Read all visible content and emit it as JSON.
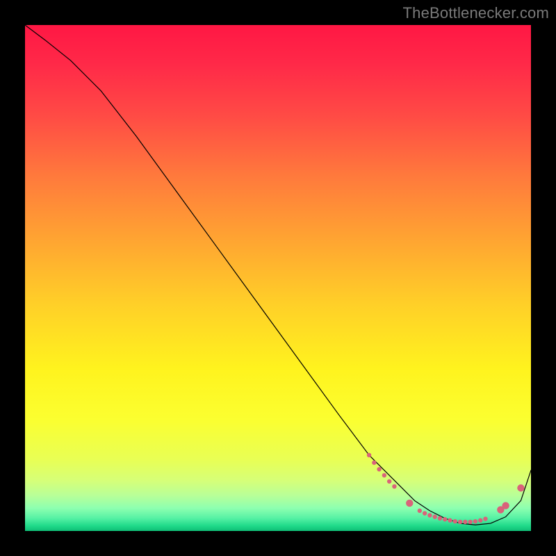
{
  "watermark": "TheBottlenecker.com",
  "chart_data": {
    "type": "line",
    "title": "",
    "xlabel": "",
    "ylabel": "",
    "xlim": [
      0,
      100
    ],
    "ylim": [
      0,
      100
    ],
    "legend": false,
    "grid": false,
    "background_gradient": {
      "stops": [
        {
          "pos": 0.0,
          "color": "#ff1744"
        },
        {
          "pos": 0.08,
          "color": "#ff2a48"
        },
        {
          "pos": 0.18,
          "color": "#ff4b45"
        },
        {
          "pos": 0.3,
          "color": "#ff7a3c"
        },
        {
          "pos": 0.42,
          "color": "#ffa332"
        },
        {
          "pos": 0.55,
          "color": "#ffcf28"
        },
        {
          "pos": 0.68,
          "color": "#fff31e"
        },
        {
          "pos": 0.78,
          "color": "#fbff30"
        },
        {
          "pos": 0.86,
          "color": "#e8ff55"
        },
        {
          "pos": 0.9,
          "color": "#d6ff78"
        },
        {
          "pos": 0.93,
          "color": "#b8ff98"
        },
        {
          "pos": 0.955,
          "color": "#8dffb0"
        },
        {
          "pos": 0.975,
          "color": "#55f1a4"
        },
        {
          "pos": 0.99,
          "color": "#1fd989"
        },
        {
          "pos": 1.0,
          "color": "#0fbf76"
        }
      ]
    },
    "series": [
      {
        "name": "curve",
        "color": "#000000",
        "width": 1.2,
        "x": [
          0,
          4,
          9,
          15,
          22,
          30,
          38,
          46,
          54,
          62,
          68,
          73,
          77,
          80,
          83,
          86,
          89,
          92,
          95,
          98,
          100
        ],
        "y": [
          100,
          97,
          93,
          87,
          78,
          67,
          56,
          45,
          34,
          23,
          15,
          10,
          6,
          4,
          2.5,
          1.5,
          1.2,
          1.5,
          2.8,
          6,
          12
        ]
      }
    ],
    "markers": {
      "name": "highlight-points",
      "color": "#d9637a",
      "radius_small": 3.2,
      "radius_large": 5.2,
      "points": [
        {
          "x": 68,
          "y": 15.0,
          "size": "small"
        },
        {
          "x": 69,
          "y": 13.5,
          "size": "small"
        },
        {
          "x": 70,
          "y": 12.2,
          "size": "small"
        },
        {
          "x": 71,
          "y": 11.0,
          "size": "small"
        },
        {
          "x": 72,
          "y": 9.8,
          "size": "small"
        },
        {
          "x": 73,
          "y": 8.8,
          "size": "small"
        },
        {
          "x": 76,
          "y": 5.5,
          "size": "large"
        },
        {
          "x": 78,
          "y": 4.0,
          "size": "small"
        },
        {
          "x": 79,
          "y": 3.5,
          "size": "small"
        },
        {
          "x": 80,
          "y": 3.1,
          "size": "small"
        },
        {
          "x": 81,
          "y": 2.8,
          "size": "small"
        },
        {
          "x": 82,
          "y": 2.5,
          "size": "small"
        },
        {
          "x": 83,
          "y": 2.3,
          "size": "small"
        },
        {
          "x": 84,
          "y": 2.1,
          "size": "small"
        },
        {
          "x": 85,
          "y": 1.9,
          "size": "small"
        },
        {
          "x": 86,
          "y": 1.8,
          "size": "small"
        },
        {
          "x": 87,
          "y": 1.8,
          "size": "small"
        },
        {
          "x": 88,
          "y": 1.8,
          "size": "small"
        },
        {
          "x": 89,
          "y": 1.9,
          "size": "small"
        },
        {
          "x": 90,
          "y": 2.1,
          "size": "small"
        },
        {
          "x": 91,
          "y": 2.4,
          "size": "small"
        },
        {
          "x": 94,
          "y": 4.2,
          "size": "large"
        },
        {
          "x": 95,
          "y": 5.0,
          "size": "large"
        },
        {
          "x": 98,
          "y": 8.5,
          "size": "large"
        }
      ]
    }
  }
}
